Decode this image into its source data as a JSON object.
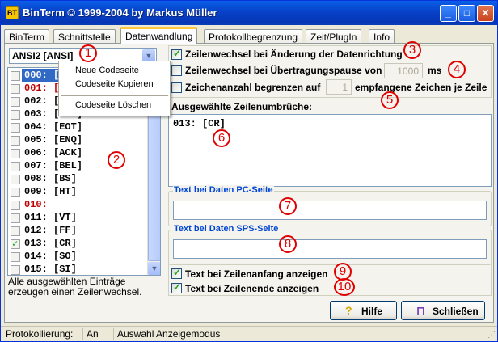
{
  "window": {
    "title": "BinTerm © 1999-2004 by Markus Müller",
    "icon_text": "BT",
    "controls": {
      "minimize": "_",
      "maximize": "□",
      "close": "✕"
    }
  },
  "tabs": [
    {
      "label": "BinTerm"
    },
    {
      "label": "Schnittstelle"
    },
    {
      "label": "Datenwandlung"
    },
    {
      "label": "Protokollbegrenzung"
    },
    {
      "label": "Zeit/PlugIn"
    },
    {
      "label": "Info"
    }
  ],
  "codepage_select": {
    "value": "ANSI2 [ANSI]",
    "arrow": "▼"
  },
  "context_menu": {
    "items": [
      "Neue Codeseite",
      "Codeseite Kopieren",
      "Codeseite Löschen"
    ]
  },
  "char_list": {
    "rows": [
      {
        "text": "000: [NUL]",
        "checked": false,
        "color": "sel"
      },
      {
        "text": "001: [SOH]",
        "checked": false,
        "color": "red"
      },
      {
        "text": "002: [STX]",
        "checked": false,
        "color": "normal"
      },
      {
        "text": "003: [ETX]",
        "checked": false,
        "color": "normal"
      },
      {
        "text": "004: [EOT]",
        "checked": false,
        "color": "normal"
      },
      {
        "text": "005: [ENQ]",
        "checked": false,
        "color": "normal"
      },
      {
        "text": "006: [ACK]",
        "checked": false,
        "color": "normal"
      },
      {
        "text": "007: [BEL]",
        "checked": false,
        "color": "normal"
      },
      {
        "text": "008: [BS]",
        "checked": false,
        "color": "normal"
      },
      {
        "text": "009: [HT]",
        "checked": false,
        "color": "normal"
      },
      {
        "text": "010:",
        "checked": false,
        "color": "red"
      },
      {
        "text": "011: [VT]",
        "checked": false,
        "color": "normal"
      },
      {
        "text": "012: [FF]",
        "checked": false,
        "color": "normal"
      },
      {
        "text": "013: [CR]",
        "checked": true,
        "color": "normal"
      },
      {
        "text": "014: [SO]",
        "checked": false,
        "color": "normal"
      },
      {
        "text": "015: [SI]",
        "checked": false,
        "color": "normal"
      }
    ],
    "note": "Alle ausgewählten Einträge erzeugen einen Zeilenwechsel."
  },
  "options": {
    "opt1": {
      "label": "Zeilenwechsel bei Änderung der Datenrichtung",
      "checked": true
    },
    "opt2": {
      "label": "Zeilenwechsel bei Übertragungspause von",
      "checked": false,
      "value": "1000",
      "unit": "ms"
    },
    "opt3": {
      "label": "Zeichenanzahl begrenzen auf",
      "checked": false,
      "value": "1",
      "suffix": "empfangene Zeichen je Zeile"
    }
  },
  "selected_breaks": {
    "label": "Ausgewählte Zeilenumbrüche:",
    "content": "013: [CR]"
  },
  "pc_group": {
    "title": "Text bei Daten PC-Seite",
    "value": ""
  },
  "sps_group": {
    "title": "Text bei Daten SPS-Seite",
    "value": ""
  },
  "show_opts": {
    "start": {
      "label": "Text bei Zeilenanfang anzeigen",
      "checked": true
    },
    "end": {
      "label": "Text bei Zeilenende anzeigen",
      "checked": true
    }
  },
  "buttons": {
    "help": "Hilfe",
    "close": "Schließen"
  },
  "status": {
    "c1": "Protokollierung:",
    "c2": "An",
    "c3": "Auswahl Anzeigemodus"
  },
  "markers": [
    "1",
    "2",
    "3",
    "4",
    "5",
    "6",
    "7",
    "8",
    "9",
    "10"
  ]
}
